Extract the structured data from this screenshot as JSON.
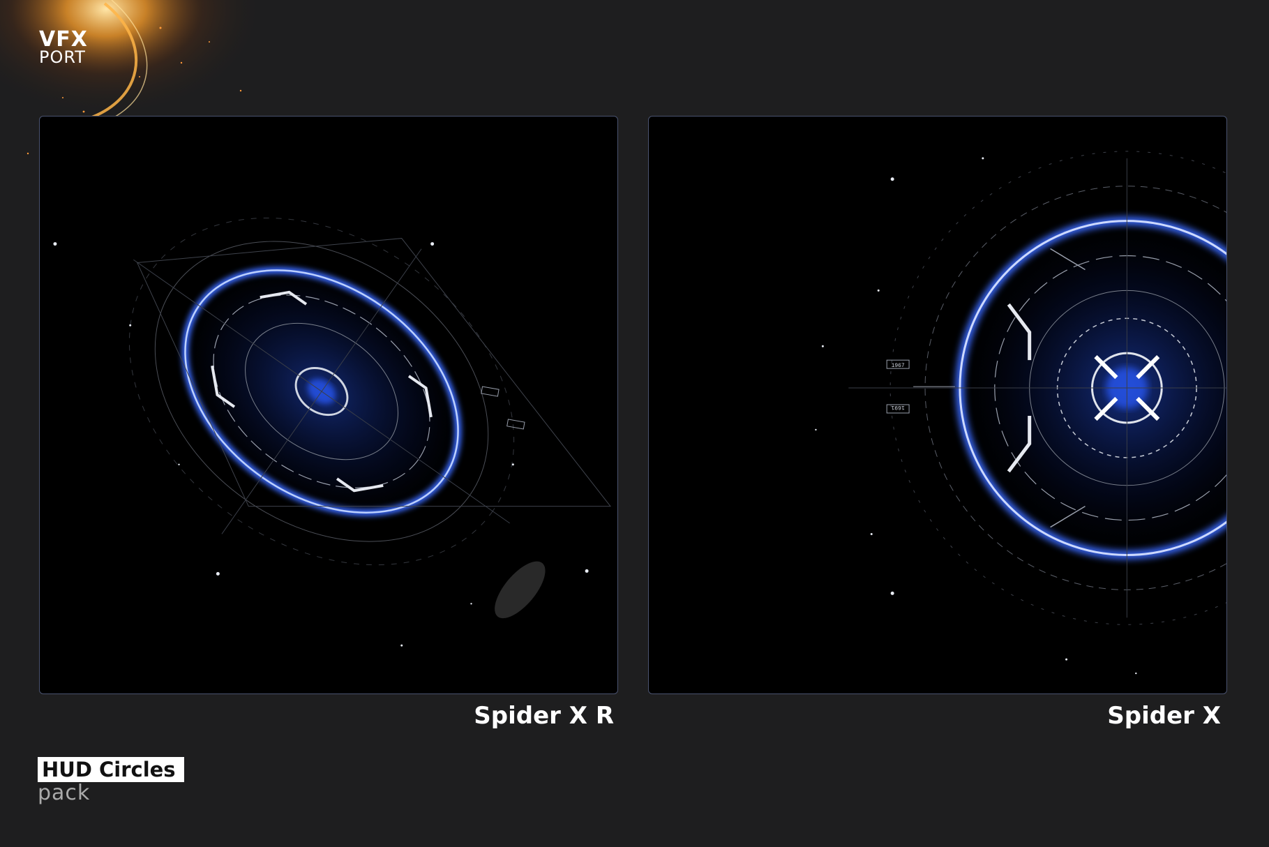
{
  "brand": {
    "name_top": "VFX",
    "name_bottom": "PORT"
  },
  "previews": [
    {
      "caption": "Spider X R",
      "variant": "tilted"
    },
    {
      "caption": "Spider X",
      "variant": "frontal"
    }
  ],
  "hud_labels": {
    "tag_a": "1967",
    "tag_b": "1691"
  },
  "pack": {
    "title": "HUD Circles",
    "subtitle": "pack"
  },
  "colors": {
    "background": "#1e1e1f",
    "accent_blue": "#2a5cff",
    "frame_border": "#4a5370"
  }
}
